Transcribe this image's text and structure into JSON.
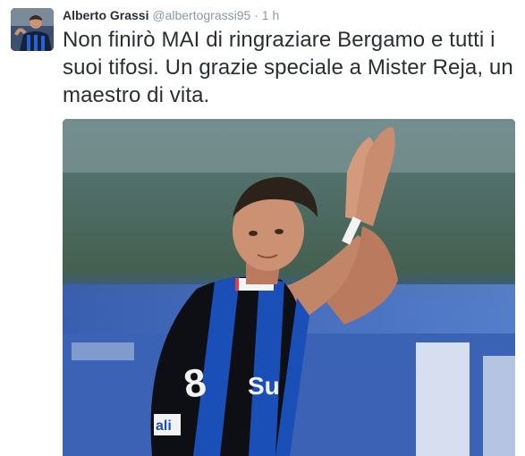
{
  "tweet": {
    "author_name": "Alberto Grassi",
    "handle": "@albertograssi95",
    "separator": " · ",
    "time": "1 h",
    "text": "Non finirò MAI di ringraziare Bergamo e tutti i suoi tifosi. Un grazie speciale a Mister Reja, un maestro di vita."
  },
  "media": {
    "shirt_text_left": "ali",
    "shirt_text_sponsor": "Su",
    "colors": {
      "stripe_blue": "#1a4fb8",
      "stripe_black": "#0d0f14",
      "skin": "#c98c6e"
    }
  },
  "colors": {
    "name": "#292f33",
    "meta": "#8899a6",
    "text": "#292f33"
  }
}
